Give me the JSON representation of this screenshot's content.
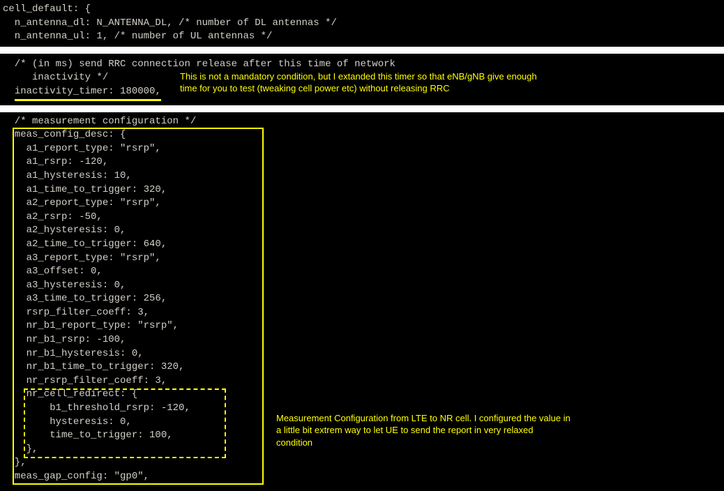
{
  "block1": {
    "l1": "cell_default: {",
    "l2": "  n_antenna_dl: N_ANTENNA_DL, /* number of DL antennas */",
    "l3": "  n_antenna_ul: 1, /* number of UL antennas */"
  },
  "block2": {
    "l1": "  /* (in ms) send RRC connection release after this time of network",
    "l2": "     inactivity */",
    "l3_pre": "  ",
    "l3_underlined": "inactivity_timer: 180000,"
  },
  "annotation1_line1": "This is not a mandatory condition, but I extanded this timer so that eNB/gNB give enough",
  "annotation1_line2": "time for you to test (tweaking cell power etc) without releasing RRC",
  "block3": {
    "c1": "  /* measurement configuration */",
    "c2": "  meas_config_desc: {",
    "c3": "    a1_report_type: \"rsrp\",",
    "c4": "    a1_rsrp: -120,",
    "c5": "    a1_hysteresis: 10,",
    "c6": "    a1_time_to_trigger: 320,",
    "c7": "    a2_report_type: \"rsrp\",",
    "c8": "    a2_rsrp: -50,",
    "c9": "    a2_hysteresis: 0,",
    "c10": "    a2_time_to_trigger: 640,",
    "c11": "    a3_report_type: \"rsrp\",",
    "c12": "    a3_offset: 0,",
    "c13": "    a3_hysteresis: 0,",
    "c14": "    a3_time_to_trigger: 256,",
    "c15": "    rsrp_filter_coeff: 3,",
    "c16": "    nr_b1_report_type: \"rsrp\",",
    "c17": "    nr_b1_rsrp: -100,",
    "c18": "    nr_b1_hysteresis: 0,",
    "c19": "    nr_b1_time_to_trigger: 320,",
    "c20": "    nr_rsrp_filter_coeff: 3,",
    "c21": "    nr_cell_redirect: {",
    "c22": "        b1_threshold_rsrp: -120,",
    "c23": "        hysteresis: 0,",
    "c24": "        time_to_trigger: 100,",
    "c25": "    },",
    "c26": "  },",
    "c27": "  meas_gap_config: \"gp0\","
  },
  "annotation2_line1": "Measurement Configuration from LTE to NR cell. I configured the value in",
  "annotation2_line2": "a little bit extrem way to let UE to send the report in very relaxed",
  "annotation2_line3": "condition"
}
